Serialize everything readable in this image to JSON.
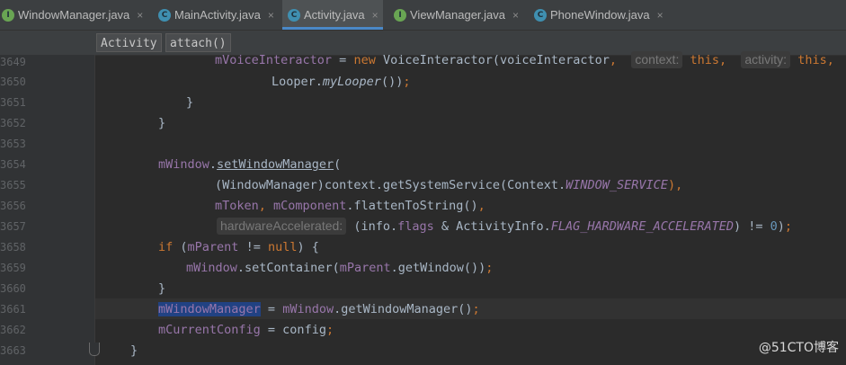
{
  "tabs": [
    {
      "label": "WindowManager.java",
      "icon": "interface-icon",
      "active": false
    },
    {
      "label": "MainActivity.java",
      "icon": "class-icon",
      "active": false
    },
    {
      "label": "Activity.java",
      "icon": "class-icon",
      "active": true
    },
    {
      "label": "ViewManager.java",
      "icon": "interface-icon",
      "active": false
    },
    {
      "label": "PhoneWindow.java",
      "icon": "class-icon",
      "active": false
    }
  ],
  "tab_close": "×",
  "icon_letters": {
    "class": "C",
    "interface": "I"
  },
  "breadcrumb": {
    "class": "Activity",
    "method": "attach()"
  },
  "line_numbers": [
    "3649",
    "3650",
    "3651",
    "3652",
    "3653",
    "3654",
    "3655",
    "3656",
    "3657",
    "3658",
    "3659",
    "3660",
    "3661",
    "3662",
    "3663"
  ],
  "code": {
    "l1": {
      "a": "mVoiceInteractor",
      "b": " = ",
      "c": "new ",
      "d": "VoiceInteractor(voiceInteractor",
      "e": ",  ",
      "hint1": "context:",
      "f": " this",
      "g": ",  ",
      "hint2": "activity:",
      "h": " this",
      "i": ","
    },
    "l2": {
      "a": "Looper.",
      "b": "myLooper",
      "c": "())",
      "d": ";"
    },
    "l3": {
      "a": "}"
    },
    "l4": {
      "a": "}"
    },
    "l5": {
      "a": "mWindow",
      "b": ".",
      "c": "setWindowManager",
      "d": "("
    },
    "l6": {
      "a": "(WindowManager)context.getSystemService(Context.",
      "b": "WINDOW_SERVICE",
      "c": "),"
    },
    "l7": {
      "a": "mToken",
      "b": ", ",
      "c": "mComponent",
      "d": ".flattenToString()",
      "e": ","
    },
    "l8": {
      "hint": "hardwareAccelerated:",
      "a": " (info.",
      "b": "flags",
      "c": " & ActivityInfo.",
      "d": "FLAG_HARDWARE_ACCELERATED",
      "e": ") != ",
      "f": "0",
      "g": ")",
      "h": ";"
    },
    "l9": {
      "a": "if",
      "b": " (",
      "c": "mParent",
      "d": " != ",
      "e": "null",
      "f": ") {"
    },
    "l10": {
      "a": "mWindow",
      "b": ".setContainer(",
      "c": "mParent",
      "d": ".getWindow())",
      "e": ";"
    },
    "l11": {
      "a": "}"
    },
    "l12": {
      "a": "mWindowManager",
      "b": " = ",
      "c": "mWindow",
      "d": ".getWindowManager()",
      "e": ";"
    },
    "l13": {
      "a": "mCurrentConfig",
      "b": " = config",
      "c": ";"
    },
    "l14": {
      "a": "}"
    }
  },
  "watermark": "@51CTO博客"
}
